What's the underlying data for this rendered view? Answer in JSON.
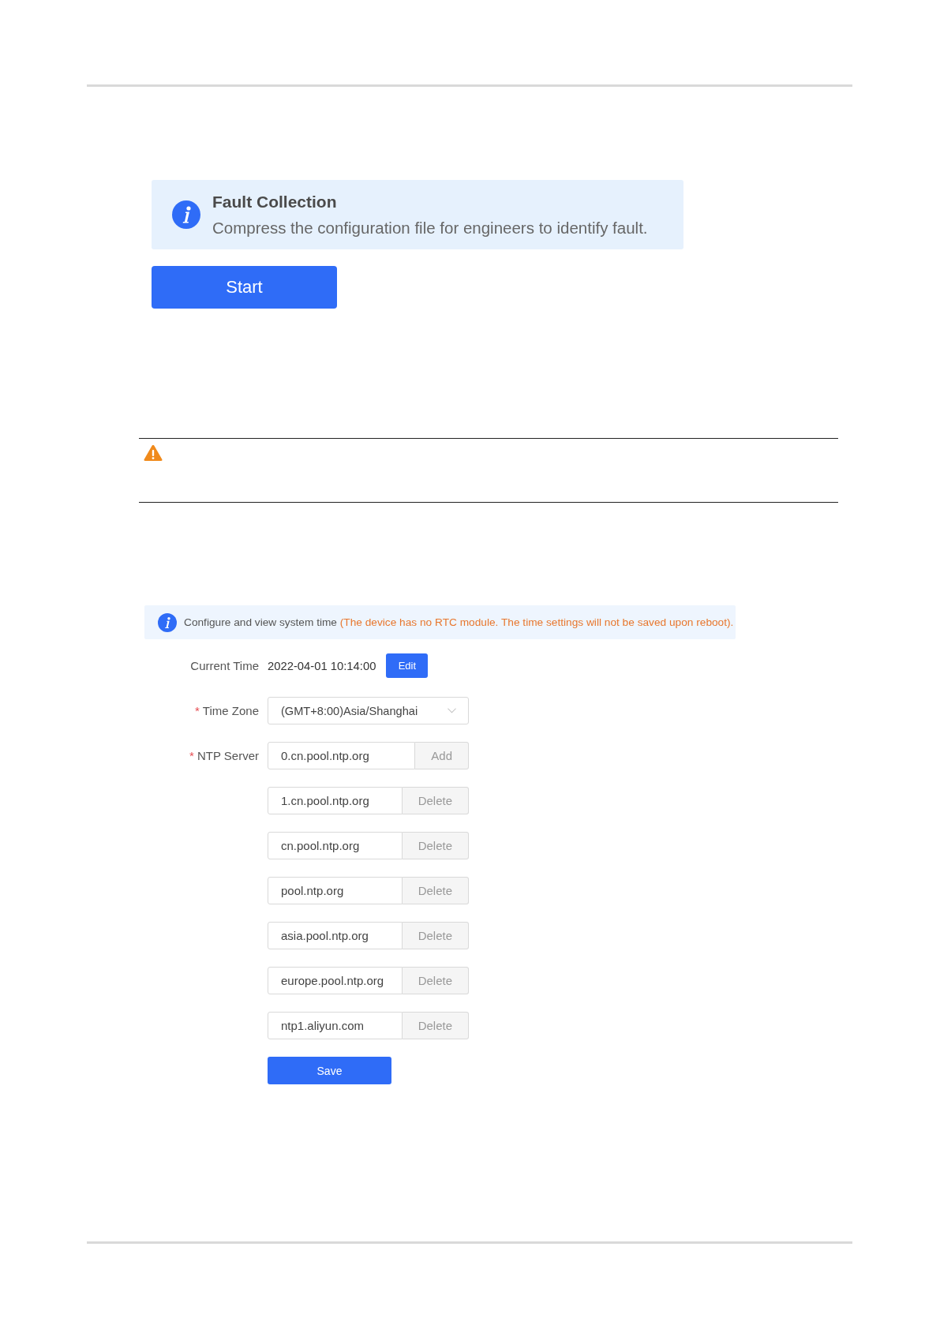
{
  "fault_collection": {
    "title": "Fault Collection",
    "description": "Compress the configuration file for engineers to identify fault.",
    "button": "Start"
  },
  "system_time": {
    "info": {
      "text": "Configure and view system time",
      "note": "(The device has no RTC module. The time settings will not be saved upon reboot)."
    },
    "required_mark": "*",
    "fields": [
      {
        "kind": "value",
        "label": "Current Time",
        "required": false,
        "value": "2022-04-01 10:14:00",
        "button": "Edit"
      },
      {
        "kind": "select",
        "label": "Time Zone",
        "required": true,
        "value": "(GMT+8:00)Asia/Shanghai"
      },
      {
        "kind": "servers",
        "label": "NTP Server",
        "required": true,
        "servers": [
          {
            "value": "0.cn.pool.ntp.org",
            "action": "Add"
          },
          {
            "value": "1.cn.pool.ntp.org",
            "action": "Delete"
          },
          {
            "value": "cn.pool.ntp.org",
            "action": "Delete"
          },
          {
            "value": "pool.ntp.org",
            "action": "Delete"
          },
          {
            "value": "asia.pool.ntp.org",
            "action": "Delete"
          },
          {
            "value": "europe.pool.ntp.org",
            "action": "Delete"
          },
          {
            "value": "ntp1.aliyun.com",
            "action": "Delete"
          }
        ]
      }
    ],
    "save_button": "Save"
  }
}
